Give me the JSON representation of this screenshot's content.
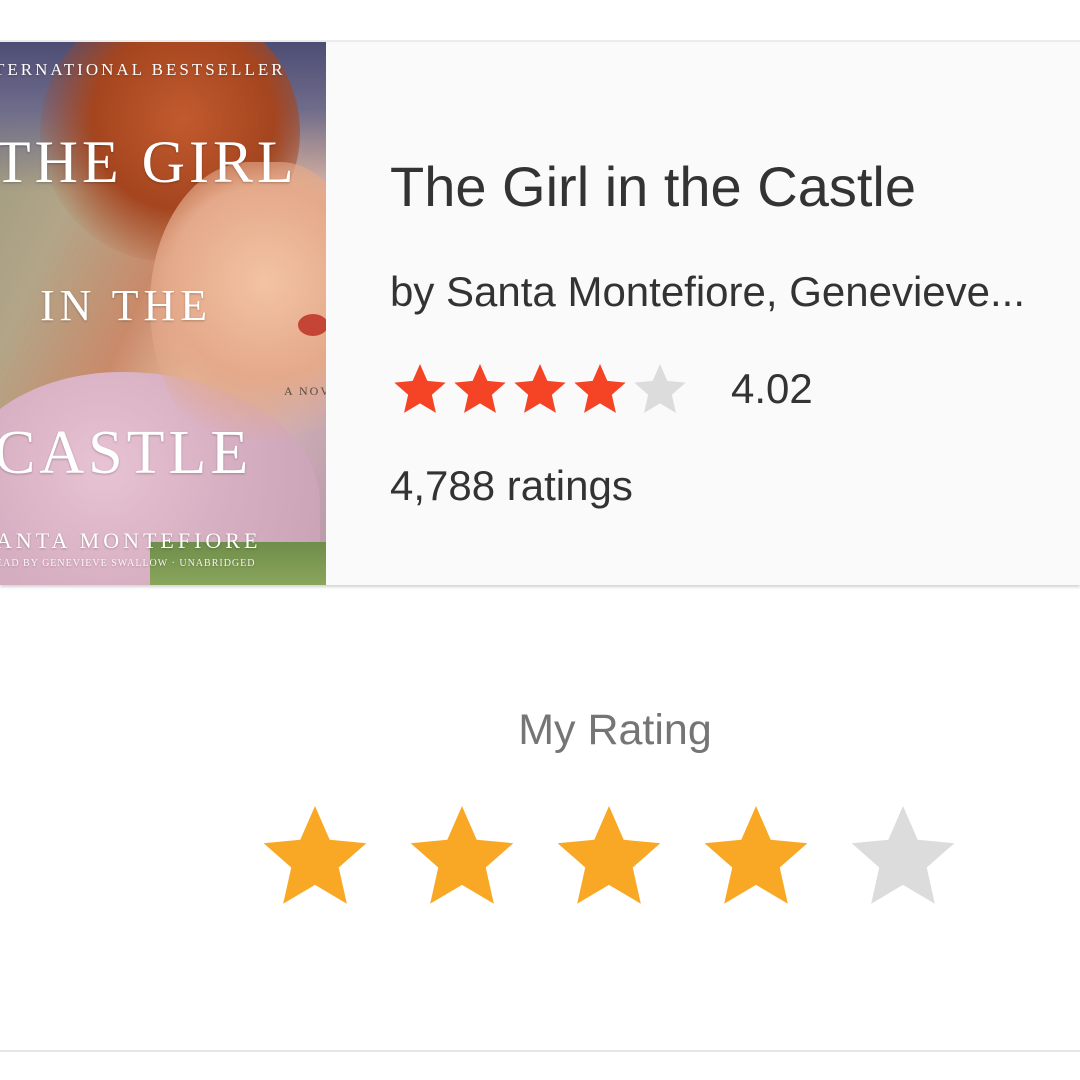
{
  "book": {
    "title": "The Girl in the Castle",
    "author": "by Santa Montefiore, Genevieve...",
    "average_rating": "4.02",
    "average_rating_stars": 4,
    "max_stars": 5,
    "ratings_count": "4,788 ratings",
    "cover": {
      "banner": "TERNATIONAL BESTSELLER",
      "title_line1": "THE GIRL",
      "title_line2": "IN THE",
      "title_line3": "CASTLE",
      "subtitle": "A NOV",
      "author": "ANTA MONTEFIORE",
      "narrator": "EAD BY GENEVIEVE SWALLOW · UNABRIDGED"
    }
  },
  "my_rating": {
    "label": "My Rating",
    "value": 4,
    "max": 5
  },
  "colors": {
    "avg_star_filled": "#f44325",
    "my_star_filled": "#f9a825",
    "star_empty": "#dcdcdc"
  },
  "icons": {
    "star": "star-icon"
  }
}
